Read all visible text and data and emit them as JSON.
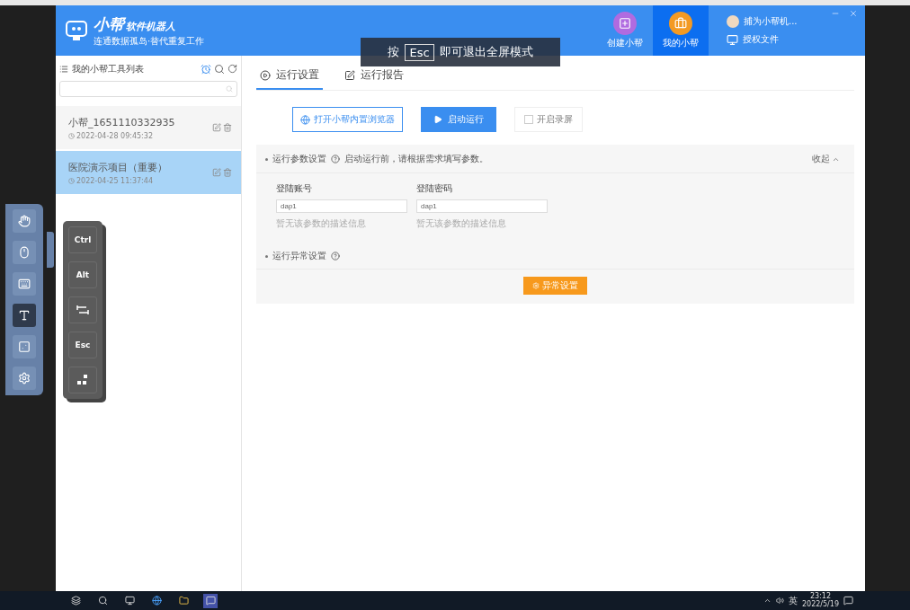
{
  "header": {
    "logo_title": "小帮",
    "logo_suffix": "软件机器人",
    "logo_subtitle": "连通数据孤岛·替代重复工作",
    "nav": [
      {
        "label": "创建小帮",
        "selected": false,
        "color": "#b06be0"
      },
      {
        "label": "我的小帮",
        "selected": true,
        "color": "#f39a23"
      }
    ],
    "user": "捕为小帮机...",
    "license": "授权文件"
  },
  "fullscreen_hint": {
    "before": "按",
    "key": "Esc",
    "after": "即可退出全屏模式"
  },
  "sidebar": {
    "title": "我的小帮工具列表",
    "items": [
      {
        "name": "小帮_1651110332935",
        "time": "2022-04-28 09:45:32",
        "selected": false
      },
      {
        "name": "医院演示项目（重要）",
        "time": "2022-04-25 11:37:44",
        "selected": true
      }
    ]
  },
  "tabs": [
    {
      "label": "运行设置",
      "selected": true
    },
    {
      "label": "运行报告",
      "selected": false
    }
  ],
  "actions": {
    "browser": "打开小帮内置浏览器",
    "run": "启动运行",
    "record": {
      "label": "开启录屏",
      "checked": false
    }
  },
  "params": {
    "title": "运行参数设置",
    "hint": "启动运行前，请根据需求填写参数。",
    "collapse": "收起",
    "fields": [
      {
        "label": "登陆账号",
        "value": "dap1",
        "note": "暂无该参数的描述信息"
      },
      {
        "label": "登陆密码",
        "value": "dap1",
        "note": "暂无该参数的描述信息"
      }
    ]
  },
  "exception": {
    "title": "运行异常设置",
    "button": "异常设置"
  },
  "side_toolbar": [
    {
      "kind": "hand",
      "selected": false
    },
    {
      "kind": "mouse",
      "selected": false
    },
    {
      "kind": "keyboard",
      "selected": false
    },
    {
      "kind": "text",
      "selected": true
    },
    {
      "kind": "dice",
      "selected": false
    },
    {
      "kind": "gear",
      "selected": false
    }
  ],
  "key_panel": [
    {
      "kind": "text",
      "label": "Ctrl"
    },
    {
      "kind": "text",
      "label": "Alt"
    },
    {
      "kind": "tab"
    },
    {
      "kind": "text",
      "label": "Esc"
    },
    {
      "kind": "dots"
    }
  ],
  "taskbar": {
    "ime": "英",
    "time": "23:12",
    "date": "2022/5/19"
  }
}
